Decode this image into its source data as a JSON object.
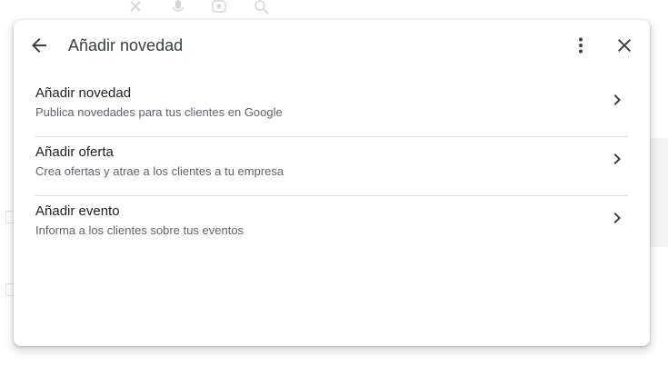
{
  "dialog": {
    "title": "Añadir novedad",
    "back_icon": "arrow-back-icon",
    "more_icon": "more-vert-icon",
    "close_icon": "close-icon"
  },
  "options": [
    {
      "title": "Añadir novedad",
      "description": "Publica novedades para tus clientes en Google",
      "icon": "chevron-right-icon"
    },
    {
      "title": "Añadir oferta",
      "description": "Crea ofertas y atrae a los clientes a tu empresa",
      "icon": "chevron-right-icon"
    },
    {
      "title": "Añadir evento",
      "description": "Informa a los clientes sobre tus eventos",
      "icon": "chevron-right-icon"
    }
  ],
  "colors": {
    "title_text": "#3c4043",
    "primary_text": "#202124",
    "secondary_text": "#5f6368",
    "divider": "#dadce0",
    "icon": "#5f6368"
  }
}
